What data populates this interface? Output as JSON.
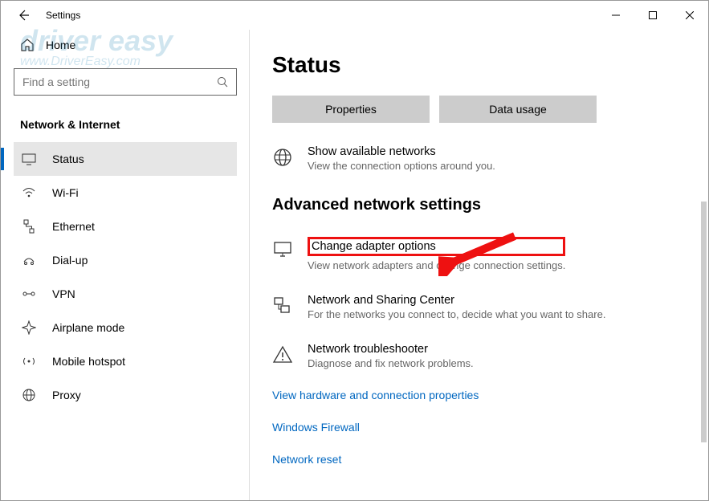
{
  "window": {
    "title": "Settings"
  },
  "sidebar": {
    "home": "Home",
    "search_placeholder": "Find a setting",
    "category": "Network & Internet",
    "items": [
      {
        "label": "Status"
      },
      {
        "label": "Wi-Fi"
      },
      {
        "label": "Ethernet"
      },
      {
        "label": "Dial-up"
      },
      {
        "label": "VPN"
      },
      {
        "label": "Airplane mode"
      },
      {
        "label": "Mobile hotspot"
      },
      {
        "label": "Proxy"
      }
    ]
  },
  "main": {
    "title": "Status",
    "buttons": {
      "properties": "Properties",
      "data_usage": "Data usage"
    },
    "show_networks": {
      "title": "Show available networks",
      "sub": "View the connection options around you."
    },
    "section": "Advanced network settings",
    "adapter": {
      "title": "Change adapter options",
      "sub": "View network adapters and change connection settings."
    },
    "sharing": {
      "title": "Network and Sharing Center",
      "sub": "For the networks you connect to, decide what you want to share."
    },
    "troubleshoot": {
      "title": "Network troubleshooter",
      "sub": "Diagnose and fix network problems."
    },
    "links": {
      "hardware": "View hardware and connection properties",
      "firewall": "Windows Firewall",
      "reset": "Network reset"
    }
  },
  "watermark": {
    "line1": "driver easy",
    "line2": "www.DriverEasy.com"
  }
}
